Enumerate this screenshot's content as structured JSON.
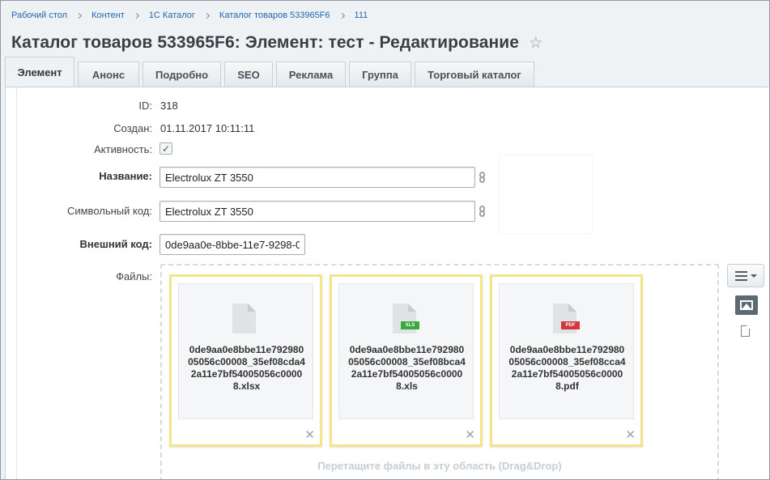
{
  "breadcrumb": [
    "Рабочий стол",
    "Контент",
    "1С Каталог",
    "Каталог товаров 533965F6",
    "111"
  ],
  "page_title": "Каталог товаров 533965F6: Элемент: тест - Редактирование",
  "icons": {
    "favorite": "star-icon",
    "link": "link-chain-icon",
    "remove": "close-icon",
    "menu": "hamburger-menu-icon",
    "image_view": "image-view-icon",
    "list_view": "document-view-icon"
  },
  "tabs": [
    {
      "label": "Элемент",
      "active": true
    },
    {
      "label": "Анонс",
      "active": false
    },
    {
      "label": "Подробно",
      "active": false
    },
    {
      "label": "SEO",
      "active": false
    },
    {
      "label": "Реклама",
      "active": false
    },
    {
      "label": "Группа",
      "active": false
    },
    {
      "label": "Торговый каталог",
      "active": false
    }
  ],
  "form": {
    "id_label": "ID:",
    "id_value": "318",
    "created_label": "Создан:",
    "created_value": "01.11.2017 10:11:11",
    "active_label": "Активность:",
    "active_checked": true,
    "name_label": "Название:",
    "name_value": "Electrolux ZT 3550",
    "code_label": "Символьный код:",
    "code_value": "Electrolux ZT 3550",
    "external_label": "Внешний код:",
    "external_value": "0de9aa0e-8bbe-11e7-9298-0",
    "files_label": "Файлы:"
  },
  "files": [
    {
      "name": "0de9aa0e8bbe11e79298005056c00008_35ef08cda42a11e7bf54005056c00008.xlsx",
      "badge": ""
    },
    {
      "name": "0de9aa0e8bbe11e79298005056c00008_35ef08bca42a11e7bf54005056c00008.xls",
      "badge": "XLS"
    },
    {
      "name": "0de9aa0e8bbe11e79298005056c00008_35ef08cca42a11e7bf54005056c00008.pdf",
      "badge": "PDF"
    }
  ],
  "drop_hint": "Перетащите файлы в эту область (Drag&Drop)",
  "colors": {
    "link": "#2067b0",
    "xls_badge": "#3aa83a",
    "pdf_badge": "#d2373a",
    "card_border": "#f2e58a"
  }
}
